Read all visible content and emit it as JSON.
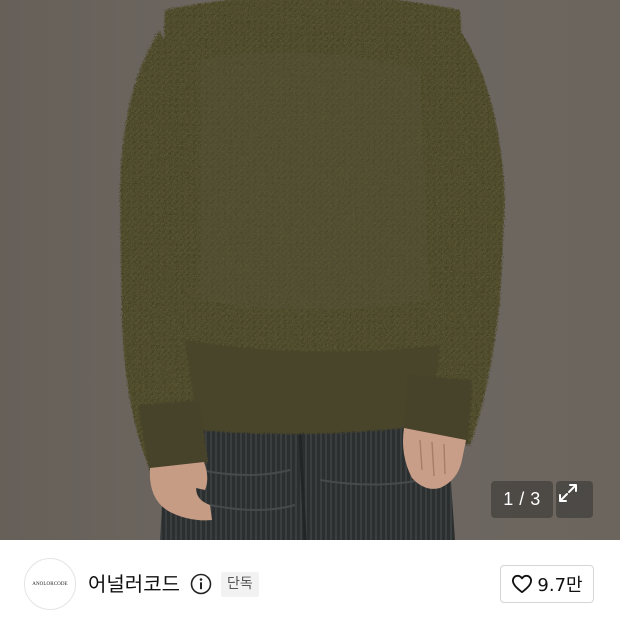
{
  "gallery": {
    "counter": "1 / 3",
    "image_subject": "fluffy olive green mohair sweater with dark corduroy pants"
  },
  "brand": {
    "logo_text": "ANOLORCODE",
    "name": "어널러코드",
    "badge": "단독"
  },
  "like": {
    "count": "9.7만"
  },
  "icons": {
    "expand": "expand-arrows-icon",
    "info": "info-icon",
    "like": "heart-icon"
  },
  "colors": {
    "sweater": "#4f4a2c",
    "background": "#6c665f",
    "pants": "#2e3030"
  }
}
